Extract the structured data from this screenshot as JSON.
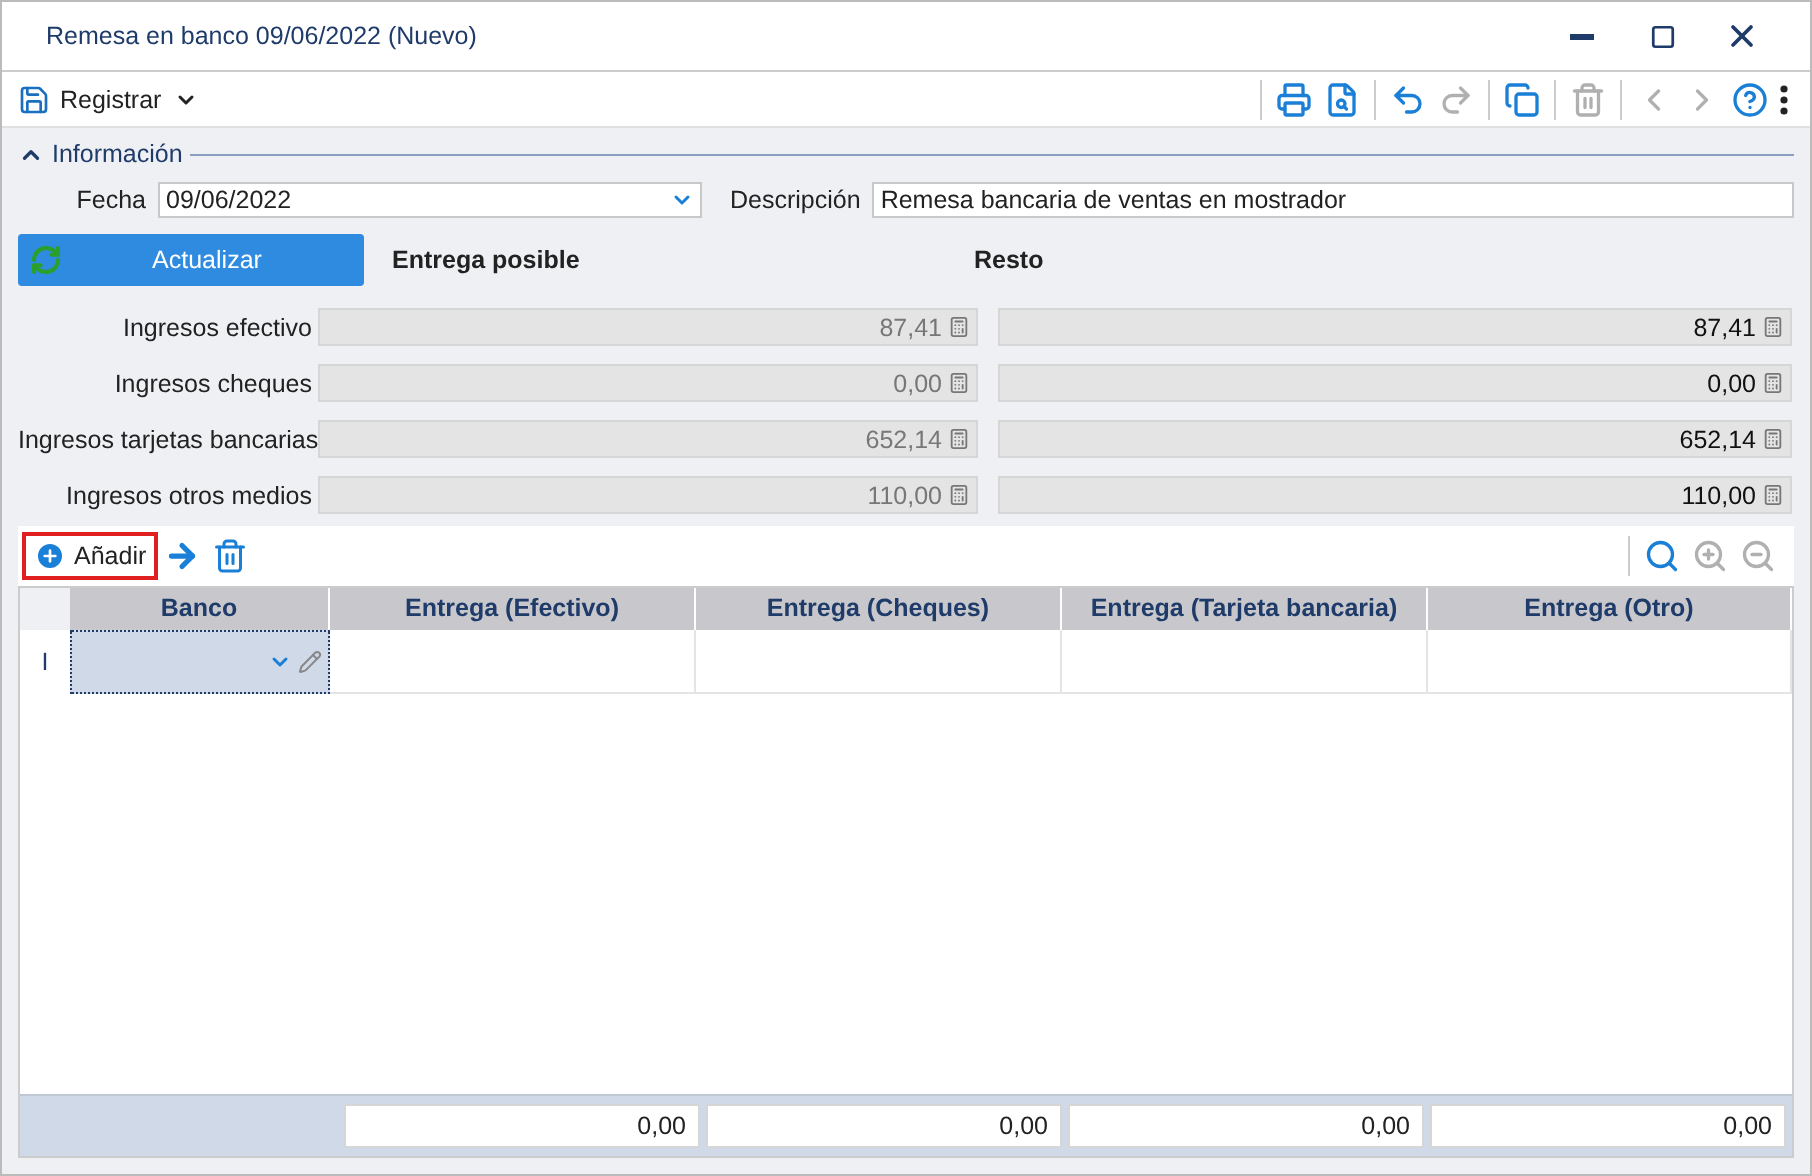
{
  "window": {
    "title": "Remesa en banco 09/06/2022 (Nuevo)"
  },
  "toolbar": {
    "main_button": "Registrar",
    "tools": [
      {
        "kind": "print",
        "disabled": false
      },
      {
        "kind": "preview",
        "disabled": false
      },
      {
        "kind": "undo",
        "disabled": false
      },
      {
        "kind": "redo",
        "disabled": true
      },
      {
        "kind": "copy",
        "disabled": false
      },
      {
        "kind": "delete",
        "disabled": true
      },
      {
        "kind": "prev",
        "disabled": true
      },
      {
        "kind": "next",
        "disabled": true
      },
      {
        "kind": "help",
        "disabled": false
      },
      {
        "kind": "more",
        "disabled": false
      }
    ]
  },
  "section": {
    "title": "Información",
    "expanded": true
  },
  "fecha": {
    "label": "Fecha",
    "value": "09/06/2022"
  },
  "descripcion": {
    "label": "Descripción",
    "value": "Remesa bancaria de ventas en mostrador"
  },
  "update_button": "Actualizar",
  "headers": [
    "Entrega posible",
    "Resto"
  ],
  "amounts": [
    {
      "label": "Ingresos efectivo",
      "posible": "87,41",
      "resto": "87,41"
    },
    {
      "label": "Ingresos cheques",
      "posible": "0,00",
      "resto": "0,00"
    },
    {
      "label": "Ingresos tarjetas bancarias",
      "posible": "652,14",
      "resto": "652,14"
    },
    {
      "label": "Ingresos otros medios",
      "posible": "110,00",
      "resto": "110,00"
    }
  ],
  "grid_toolbar": {
    "add_button": {
      "label": "Añadir",
      "highlighted": true
    },
    "tools": [
      {
        "kind": "search",
        "disabled": false
      },
      {
        "kind": "zoom-in",
        "disabled": true
      },
      {
        "kind": "zoom-out",
        "disabled": true
      }
    ]
  },
  "table": {
    "columns": [
      "Banco",
      "Entrega (Efectivo)",
      "Entrega (Cheques)",
      "Entrega (Tarjeta bancaria)",
      "Entrega (Otro)"
    ],
    "rows": [
      {
        "indicator": "I",
        "selected": true
      }
    ],
    "totals": [
      "0,00",
      "0,00",
      "0,00",
      "0,00"
    ]
  }
}
